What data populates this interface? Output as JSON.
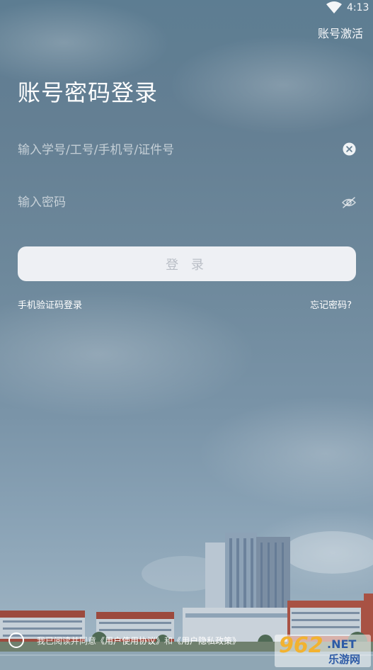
{
  "status_bar": {
    "time": "4:13",
    "wifi_icon": "wifi-icon"
  },
  "header": {
    "activate_label": "账号激活"
  },
  "login": {
    "title": "账号密码登录",
    "account_placeholder": "输入学号/工号/手机号/证件号",
    "account_value": "",
    "password_placeholder": "输入密码",
    "password_value": "",
    "clear_icon": "clear-circle-icon",
    "visibility_icon": "eye-off-icon",
    "submit_label": "登 录",
    "sms_login_label": "手机验证码登录",
    "forgot_label": "忘记密码?"
  },
  "agreement": {
    "prefix": "我已阅读并同意",
    "user_agreement": "《用户使用协议》",
    "conjunction": "和",
    "privacy_policy": "《用户隐私政策》"
  },
  "watermark": {
    "number": "962",
    "net": ".NET",
    "cn": "乐游网"
  },
  "colors": {
    "button_bg": "#eef0f4",
    "button_text": "#b9bec6",
    "text": "#ffffff"
  }
}
